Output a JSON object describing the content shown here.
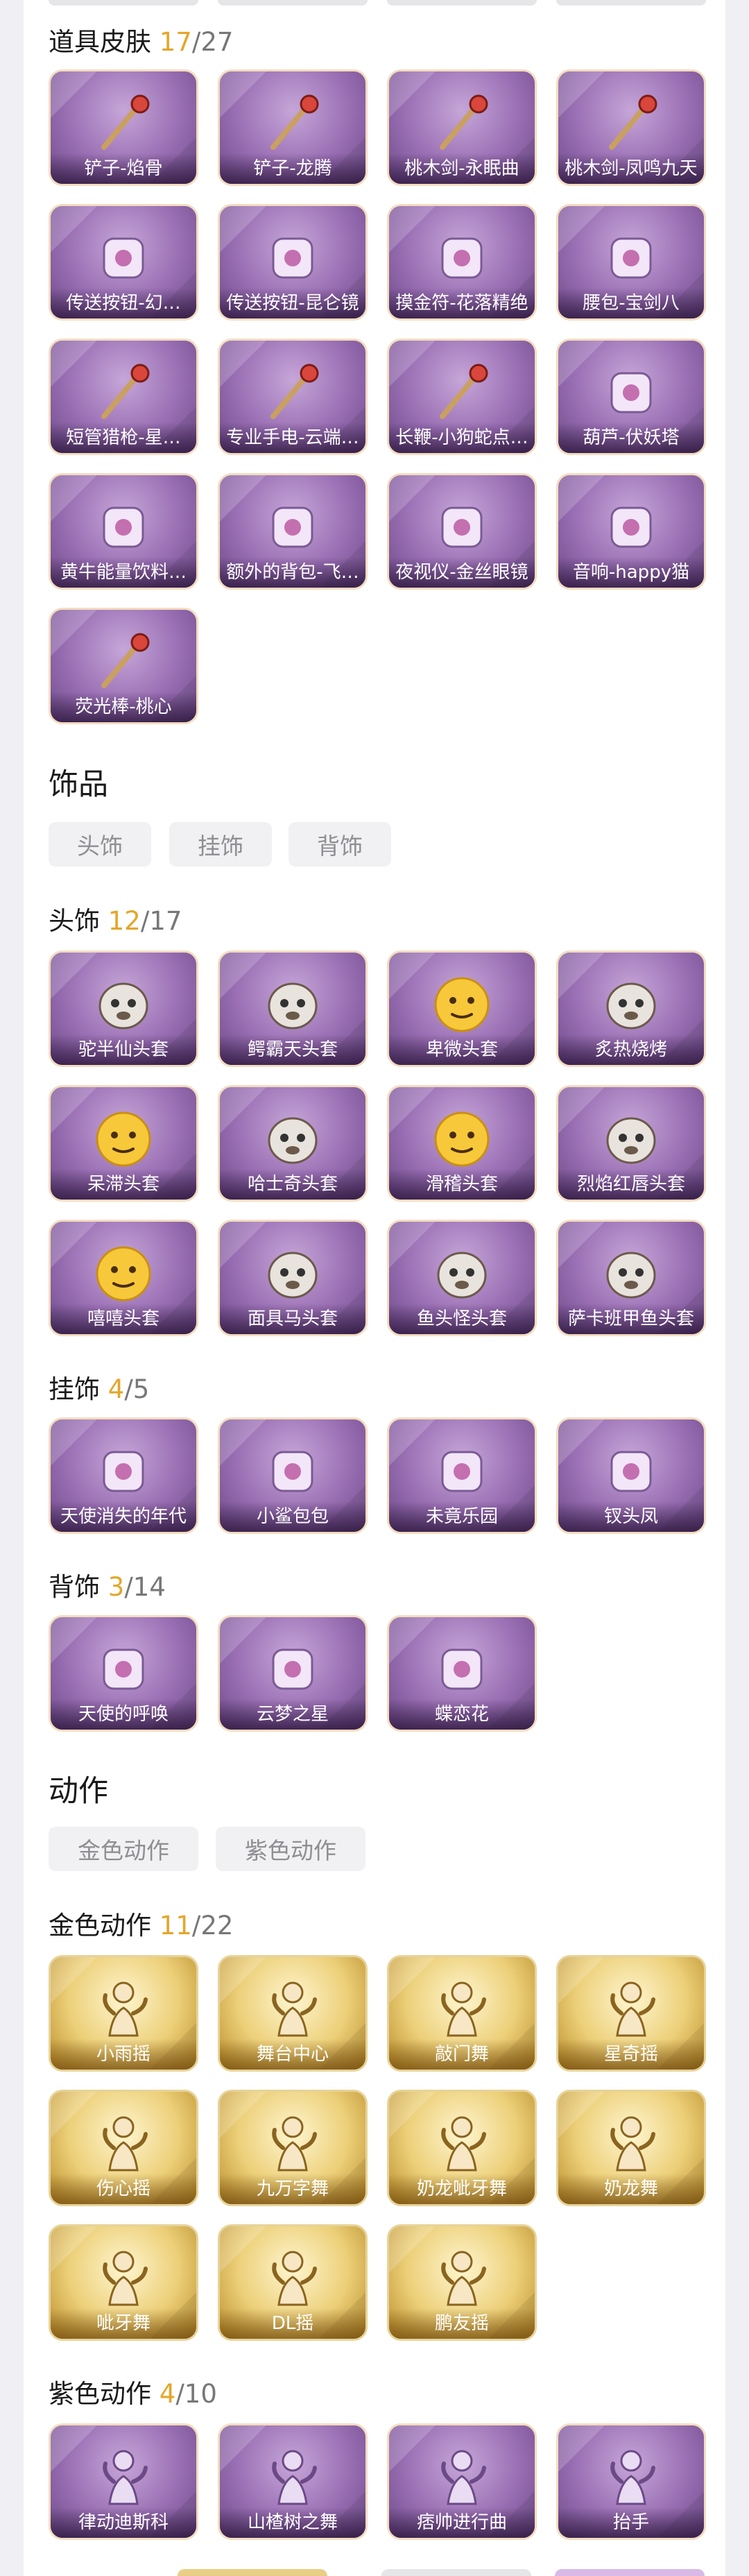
{
  "colors": {
    "accent_count": "#e4a62a",
    "card_purple": "#9a6fb4",
    "card_gold": "#eccf78",
    "chip_bg": "#f1f1f3",
    "chip_text": "#8e8e93"
  },
  "prop_skins": {
    "title": "道具皮肤",
    "count": "17",
    "total": "/27",
    "items": [
      {
        "label": "铲子-焰骨",
        "icon": "shovel-icon"
      },
      {
        "label": "铲子-龙腾",
        "icon": "shovel-icon"
      },
      {
        "label": "桃木剑-永眠曲",
        "icon": "sword-icon"
      },
      {
        "label": "桃木剑-凤鸣九天",
        "icon": "sword-icon"
      },
      {
        "label": "传送按钮-幻…",
        "icon": "device-icon"
      },
      {
        "label": "传送按钮-昆仑镜",
        "icon": "mirror-icon"
      },
      {
        "label": "摸金符-花落精绝",
        "icon": "amulet-icon"
      },
      {
        "label": "腰包-宝剑八",
        "icon": "bag-icon"
      },
      {
        "label": "短管猎枪-星…",
        "icon": "gun-icon"
      },
      {
        "label": "专业手电-云端…",
        "icon": "flashlight-icon"
      },
      {
        "label": "长鞭-小狗蛇点…",
        "icon": "whip-icon"
      },
      {
        "label": "葫芦-伏妖塔",
        "icon": "gourd-icon"
      },
      {
        "label": "黄牛能量饮料…",
        "icon": "bottle-icon"
      },
      {
        "label": "额外的背包-飞…",
        "icon": "backpack-icon"
      },
      {
        "label": "夜视仪-金丝眼镜",
        "icon": "glasses-icon"
      },
      {
        "label": "音响-happy猫",
        "icon": "cat-icon"
      },
      {
        "label": "荧光棒-桃心",
        "icon": "heart-wand-icon"
      }
    ]
  },
  "accessories": {
    "title": "饰品",
    "chips": [
      "头饰",
      "挂饰",
      "背饰"
    ]
  },
  "headwear": {
    "title": "头饰",
    "count": "12",
    "total": "/17",
    "items": [
      {
        "label": "驼半仙头套",
        "icon": "panda-head-icon"
      },
      {
        "label": "鳄霸天头套",
        "icon": "crocodile-head-icon"
      },
      {
        "label": "卑微头套",
        "icon": "emoji-head-icon"
      },
      {
        "label": "炙热烧烤",
        "icon": "bbq-head-icon"
      },
      {
        "label": "呆滞头套",
        "icon": "emoji-head-icon"
      },
      {
        "label": "哈士奇头套",
        "icon": "husky-head-icon"
      },
      {
        "label": "滑稽头套",
        "icon": "emoji-head-icon"
      },
      {
        "label": "烈焰红唇头套",
        "icon": "pikachu-head-icon"
      },
      {
        "label": "嘻嘻头套",
        "icon": "emoji-head-icon"
      },
      {
        "label": "面具马头套",
        "icon": "horse-head-icon"
      },
      {
        "label": "鱼头怪头套",
        "icon": "fish-head-icon"
      },
      {
        "label": "萨卡班甲鱼头套",
        "icon": "fish-head-icon"
      }
    ]
  },
  "hanging": {
    "title": "挂饰",
    "count": "4",
    "total": "/5",
    "items": [
      {
        "label": "天使消失的年代",
        "icon": "angel-icon"
      },
      {
        "label": "小鲨包包",
        "icon": "shark-icon"
      },
      {
        "label": "未竟乐园",
        "icon": "bunny-icon"
      },
      {
        "label": "钗头凤",
        "icon": "phoenix-icon"
      }
    ]
  },
  "back": {
    "title": "背饰",
    "count": "3",
    "total": "/14",
    "items": [
      {
        "label": "天使的呼唤",
        "icon": "angel-icon"
      },
      {
        "label": "云梦之星",
        "icon": "unicorn-icon"
      },
      {
        "label": "蝶恋花",
        "icon": "butterfly-icon"
      }
    ]
  },
  "actions": {
    "title": "动作",
    "chips": [
      "金色动作",
      "紫色动作"
    ]
  },
  "gold_actions": {
    "title": "金色动作",
    "count": "11",
    "total": "/22",
    "items": [
      {
        "label": "小雨摇",
        "icon": "dance-icon"
      },
      {
        "label": "舞台中心",
        "icon": "dance-icon"
      },
      {
        "label": "敲门舞",
        "icon": "dance-icon"
      },
      {
        "label": "星奇摇",
        "icon": "dance-icon"
      },
      {
        "label": "伤心摇",
        "icon": "dance-icon"
      },
      {
        "label": "九万字舞",
        "icon": "dance-icon"
      },
      {
        "label": "奶龙呲牙舞",
        "icon": "dance-icon"
      },
      {
        "label": "奶龙舞",
        "icon": "dance-icon"
      },
      {
        "label": "呲牙舞",
        "icon": "dance-icon"
      },
      {
        "label": "DL摇",
        "icon": "dance-icon"
      },
      {
        "label": "鹏友摇",
        "icon": "dance-icon"
      }
    ]
  },
  "purple_actions": {
    "title": "紫色动作",
    "count": "4",
    "total": "/10",
    "items": [
      {
        "label": "律动迪斯科",
        "icon": "dance-icon"
      },
      {
        "label": "山楂树之舞",
        "icon": "dance-icon"
      },
      {
        "label": "痞帅进行曲",
        "icon": "dance-icon"
      },
      {
        "label": "抬手",
        "icon": "dance-icon"
      }
    ]
  }
}
